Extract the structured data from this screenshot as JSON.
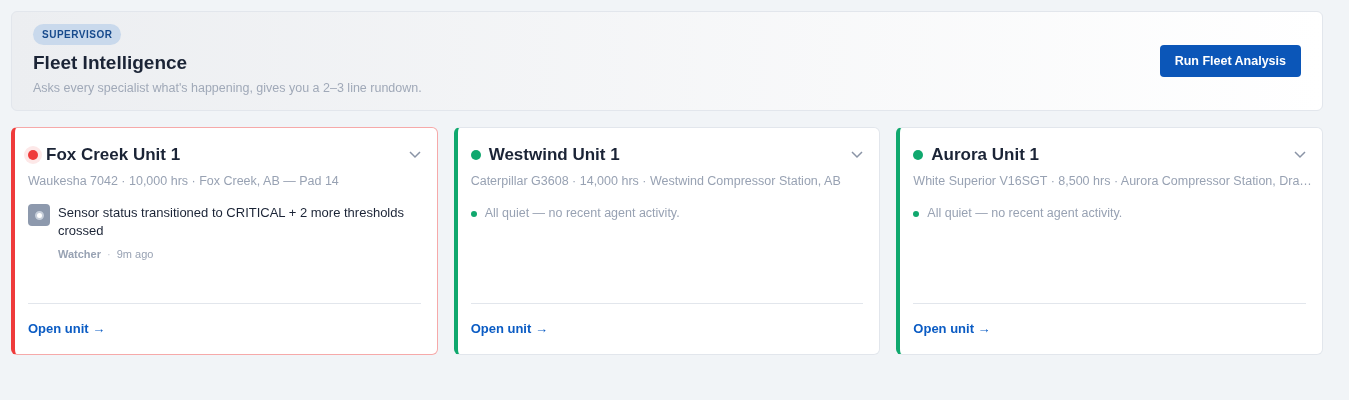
{
  "header": {
    "badge": "SUPERVISOR",
    "title": "Fleet Intelligence",
    "subtitle": "Asks every specialist what's happening, gives you a 2–3 line rundown.",
    "button": "Run Fleet Analysis"
  },
  "units": [
    {
      "name": "Fox Creek Unit 1",
      "critical": true,
      "color": "#ef3b3b",
      "details": "Waukesha 7042 · 10,000 hrs · Fox Creek, AB — Pad 14",
      "events": [
        {
          "text": "Sensor status transitioned to CRITICAL + 2 more thresholds crossed",
          "agent": "Watcher",
          "sep": "·",
          "time": "9m ago"
        }
      ],
      "link": "Open unit →"
    },
    {
      "name": "Westwind Unit 1",
      "critical": false,
      "color": "#10a86e",
      "details": "Caterpillar G3608 · 14,000 hrs · Westwind Compressor Station, AB",
      "quiet": "All quiet — no recent agent activity.",
      "link": "Open unit →"
    },
    {
      "name": "Aurora Unit 1",
      "critical": false,
      "color": "#10a86e",
      "details": "White Superior V16SGT · 8,500 hrs · Aurora Compressor Station, Dra…",
      "quiet": "All quiet — no recent agent activity.",
      "link": "Open unit →"
    }
  ]
}
